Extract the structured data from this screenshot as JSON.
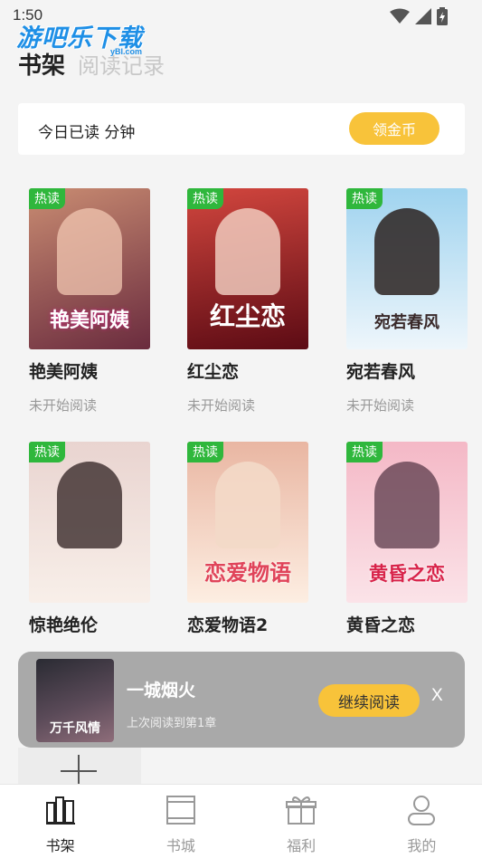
{
  "status": {
    "time": "1:50"
  },
  "watermark": {
    "text": "游吧乐下载",
    "sub": "yBl.com"
  },
  "tabs": {
    "bookshelf": "书架",
    "history": "阅读记录"
  },
  "reading_bar": {
    "text": "今日已读  分钟",
    "coin_button": "领金币"
  },
  "hot_badge": "热读",
  "books": [
    {
      "title": "艳美阿姨",
      "cover_text": "艳美阿姨",
      "status": "未开始阅读",
      "colors": [
        "#c98c72",
        "#6a2b3e"
      ]
    },
    {
      "title": "红尘恋",
      "cover_text": "红尘恋",
      "status": "未开始阅读",
      "colors": [
        "#d2463e",
        "#5c0b14"
      ]
    },
    {
      "title": "宛若春风",
      "cover_text": "宛若春风",
      "status": "未开始阅读",
      "colors": [
        "#9fd3ef",
        "#eef6fb"
      ]
    },
    {
      "title": "惊艳绝伦",
      "cover_text": "",
      "status": "未开始阅读",
      "colors": [
        "#e9d4d0",
        "#f8efe9"
      ]
    },
    {
      "title": "恋爱物语2",
      "cover_text": "恋爱物语",
      "status": "未开始阅读",
      "colors": [
        "#e9b6a2",
        "#fdeee2"
      ]
    },
    {
      "title": "黄昏之恋",
      "cover_text": "黄昏之恋",
      "status": "未开始阅读",
      "colors": [
        "#f4b8c6",
        "#fbe3e8"
      ]
    }
  ],
  "mini_player": {
    "cover_text": "万千风情",
    "title": "一城烟火",
    "subtitle": "上次阅读到第1章",
    "continue_button": "继续阅读",
    "close": "X"
  },
  "nav": [
    {
      "label": "书架",
      "icon": "bookshelf-icon",
      "active": true
    },
    {
      "label": "书城",
      "icon": "bookstore-icon",
      "active": false
    },
    {
      "label": "福利",
      "icon": "gift-icon",
      "active": false
    },
    {
      "label": "我的",
      "icon": "profile-icon",
      "active": false
    }
  ],
  "colors": {
    "accent": "#f8c33a",
    "hot": "#2fb73c"
  }
}
